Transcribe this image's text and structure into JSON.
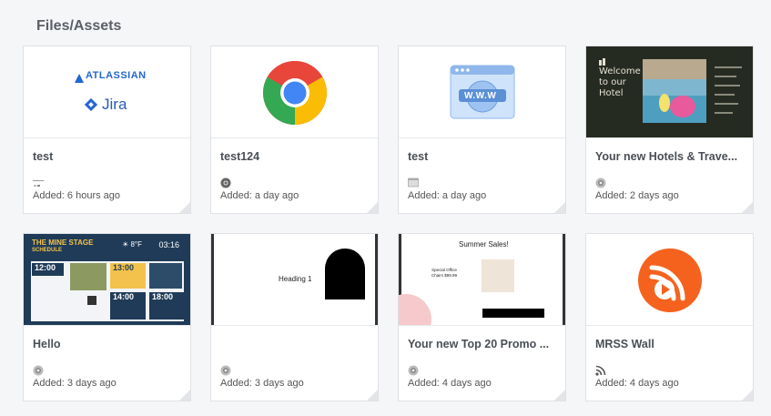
{
  "header": {
    "title": "Files/Assets"
  },
  "cards": [
    {
      "title": "test",
      "added": "Added: 6 hours ago",
      "type_icon": "document-icon",
      "thumb": {
        "atlassian_text": "ATLASSIAN",
        "jira_text": "Jira"
      }
    },
    {
      "title": "test124",
      "added": "Added: a day ago",
      "type_icon": "chrome-icon"
    },
    {
      "title": "test",
      "added": "Added: a day ago",
      "type_icon": "web-icon",
      "thumb": {
        "www_text": "W.W.W"
      }
    },
    {
      "title": "Your new Hotels & Trave...",
      "added": "Added: 2 days ago",
      "type_icon": "globe-icon",
      "thumb": {
        "welcome_text": "Welcome to our Hotel"
      }
    },
    {
      "title": "Hello",
      "added": "Added: 3 days ago",
      "type_icon": "globe-icon",
      "thumb": {
        "stage_title": "THE MINE STAGE",
        "stage_subtitle": "SCHEDULE",
        "temp": "☀ 8°F",
        "clock": "03:16",
        "times": [
          "12:00",
          "13:00",
          "14:00",
          "18:00"
        ]
      }
    },
    {
      "title": "",
      "added": "Added: 3 days ago",
      "type_icon": "globe-icon",
      "thumb": {
        "heading_text": "Heading 1"
      }
    },
    {
      "title": "Your new Top 20 Promo ...",
      "added": "Added: 4 days ago",
      "type_icon": "globe-icon",
      "thumb": {
        "sales_title": "Summer Sales!",
        "sales_offer": "Special Office Chairs $99.99"
      }
    },
    {
      "title": "MRSS Wall",
      "added": "Added: 4 days ago",
      "type_icon": "rss-icon"
    }
  ],
  "colors": {
    "accent_blue": "#2466d1",
    "rss_orange": "#f5621e",
    "page_bg": "#f5f6f8"
  }
}
